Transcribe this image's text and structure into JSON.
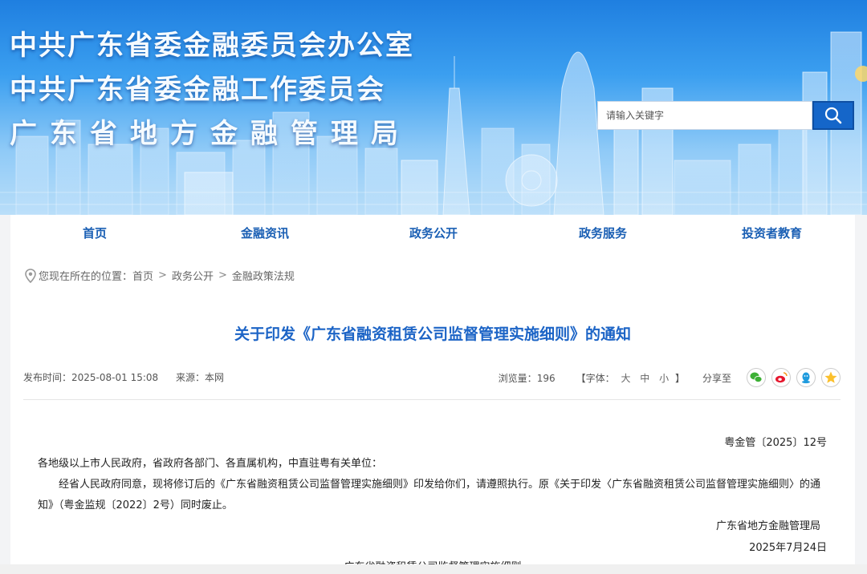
{
  "header": {
    "titles": [
      "中共广东省委金融委员会办公室",
      "中共广东省委金融工作委员会",
      "广东省地方金融管理局"
    ],
    "search_placeholder": "请输入关键字",
    "search_icon": "search-icon"
  },
  "nav": {
    "items": [
      "首页",
      "金融资讯",
      "政务公开",
      "政务服务",
      "投资者教育"
    ]
  },
  "breadcrumb": {
    "prefix": "您现在所在的位置：",
    "items": [
      "首页",
      "政务公开",
      "金融政策法规"
    ],
    "separator": ">",
    "icon": "location-pin-icon"
  },
  "article": {
    "title": "关于印发《广东省融资租赁公司监督管理实施细则》的通知",
    "publish_label": "发布时间：",
    "publish_time": "2025-08-01 15:08",
    "source_label": "来源：",
    "source": "本网",
    "views_label": "浏览量：",
    "views": "196",
    "font_label_open": "【字体：",
    "font_sizes": [
      "大",
      "中",
      "小"
    ],
    "font_label_close": "】",
    "share_label": "分享至",
    "share_icons": [
      "wechat-icon",
      "weibo-icon",
      "qq-icon",
      "qzone-icon"
    ],
    "doc_number": "粤金管〔2025〕12号",
    "addressee": "各地级以上市人民政府，省政府各部门、各直属机构，中直驻粤有关单位：",
    "paragraph": "经省人民政府同意，现将修订后的《广东省融资租赁公司监督管理实施细则》印发给你们，请遵照执行。原《关于印发〈广东省融资租赁公司监督管理实施细则〉的通知》（粤金监规〔2022〕2号）同时废止。",
    "signature": "广东省地方金融管理局",
    "date": "2025年7月24日",
    "next_heading": "广东省融资租赁公司监督管理实施细则"
  },
  "colors": {
    "nav_text": "#1a5fb4",
    "title_text": "#1c64c6",
    "search_button": "#1566c9"
  }
}
